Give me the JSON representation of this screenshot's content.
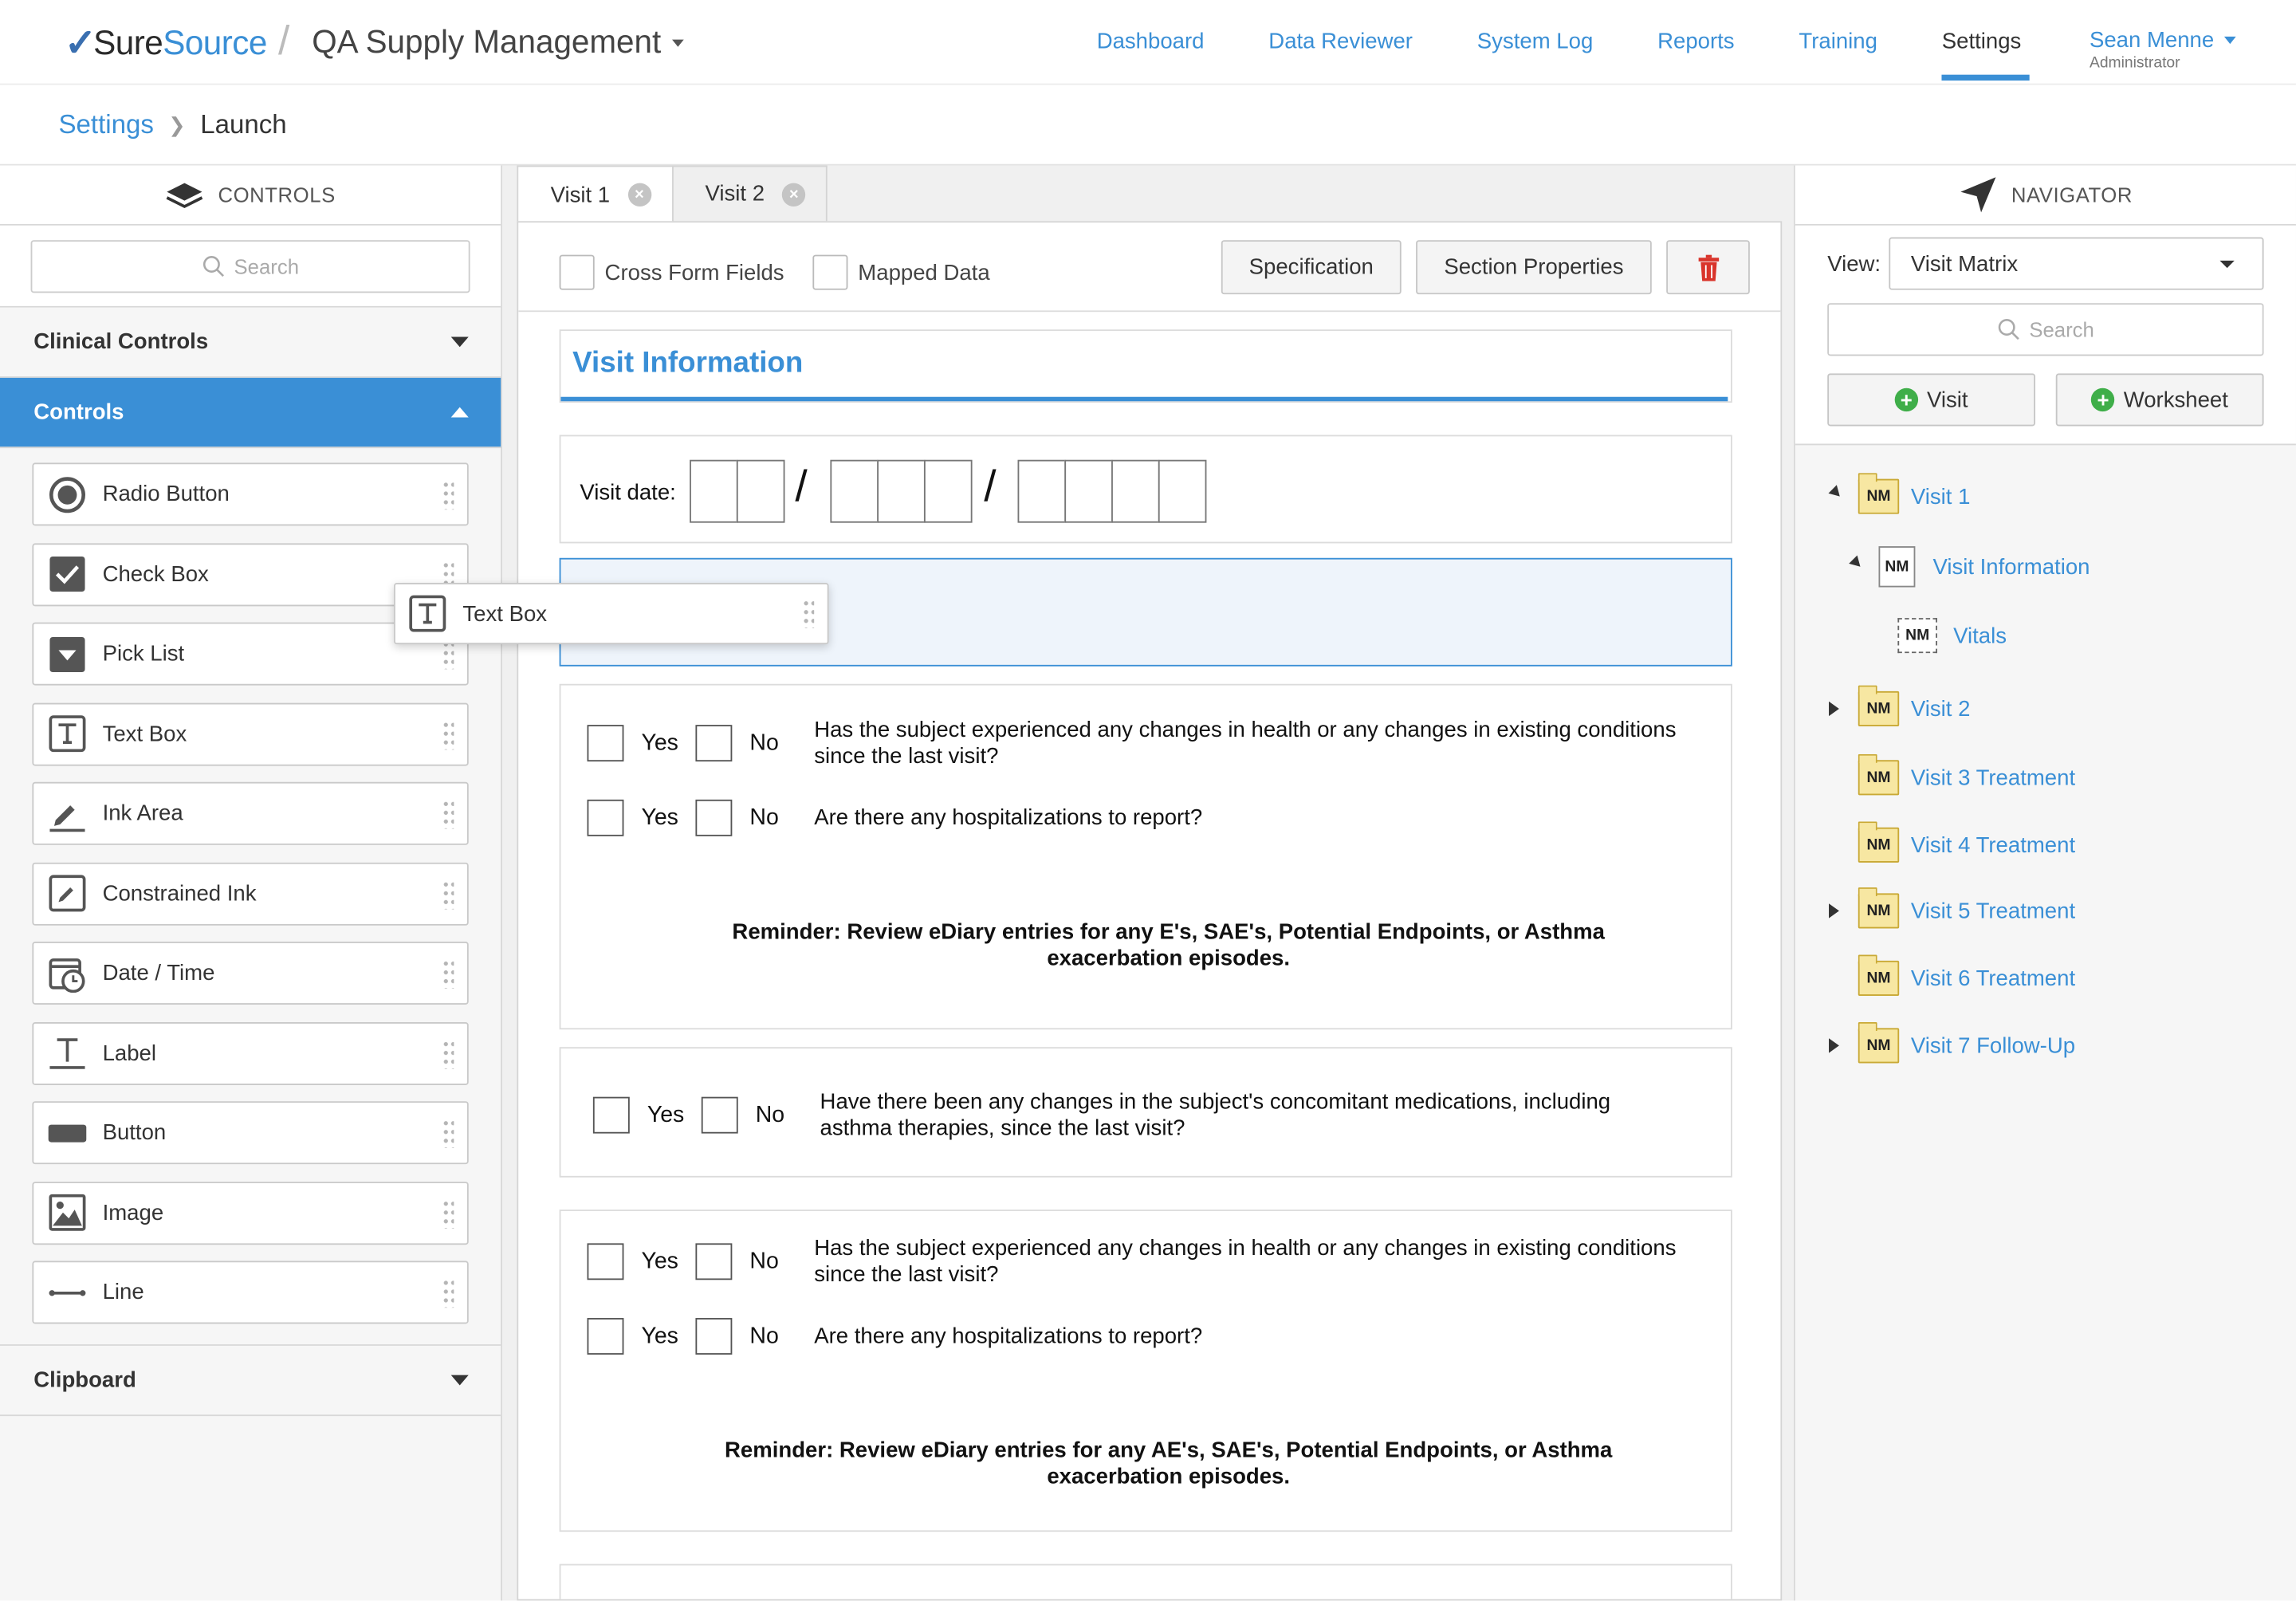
{
  "header": {
    "logo_sure": "Sure",
    "logo_source": "Source",
    "app_title": "QA Supply Management",
    "nav": [
      "Dashboard",
      "Data Reviewer",
      "System Log",
      "Reports",
      "Training",
      "Settings"
    ],
    "nav_active": "Settings",
    "user_name": "Sean Menne",
    "user_role": "Administrator"
  },
  "breadcrumb": {
    "parent": "Settings",
    "current": "Launch"
  },
  "left_panel": {
    "title": "CONTROLS",
    "search_placeholder": "Search",
    "sections": {
      "clinical": "Clinical Controls",
      "controls": "Controls",
      "clipboard": "Clipboard"
    },
    "controls": [
      {
        "label": "Radio Button",
        "icon": "radio-button-icon"
      },
      {
        "label": "Check Box",
        "icon": "check-box-icon"
      },
      {
        "label": "Pick List",
        "icon": "pick-list-icon"
      },
      {
        "label": "Text Box",
        "icon": "text-box-icon"
      },
      {
        "label": "Ink Area",
        "icon": "ink-area-icon"
      },
      {
        "label": "Constrained Ink",
        "icon": "constrained-ink-icon"
      },
      {
        "label": "Date / Time",
        "icon": "date-time-icon"
      },
      {
        "label": "Label",
        "icon": "label-icon"
      },
      {
        "label": "Button",
        "icon": "button-icon"
      },
      {
        "label": "Image",
        "icon": "image-icon"
      },
      {
        "label": "Line",
        "icon": "line-icon"
      }
    ],
    "drag_ghost_label": "Text Box"
  },
  "center": {
    "tabs": [
      "Visit 1",
      "Visit 2"
    ],
    "toolbar": {
      "cross_form": "Cross Form Fields",
      "mapped_data": "Mapped Data",
      "specification": "Specification",
      "section_properties": "Section Properties"
    },
    "section_title": "Visit Information",
    "visit_date_label": "Visit date:",
    "yes": "Yes",
    "no": "No",
    "q_health": "Has the subject experienced any changes in health or any changes in existing conditions since the last visit?",
    "q_health_line1": "Has the subject experienced any changes in health or any changes in existing conditions",
    "q_health_line2": "since the last visit?",
    "q_hosp": "Are there any hospitalizations to report?",
    "q_meds_line1": "Have there been any changes in the subject's concomitant medications, including",
    "q_meds_line2": "asthma therapies, since the last visit?",
    "reminder1_line1": "Reminder:  Review eDiary entries for any   E's, SAE's, Potential Endpoints, or Asthma",
    "reminder2_line1": "Reminder:  Review eDiary entries for any AE's, SAE's, Potential Endpoints, or Asthma",
    "reminder_line2": "exacerbation episodes."
  },
  "right_panel": {
    "title": "NAVIGATOR",
    "view_label": "View:",
    "view_value": "Visit Matrix",
    "search_placeholder": "Search",
    "add_visit": "Visit",
    "add_worksheet": "Worksheet",
    "nm": "NM",
    "tree": {
      "visit1": "Visit 1",
      "visit_info": "Visit Information",
      "vitals": "Vitals",
      "visit2": "Visit 2",
      "visit3": "Visit 3 Treatment",
      "visit4": "Visit 4 Treatment",
      "visit5": "Visit 5 Treatment",
      "visit6": "Visit 6 Treatment",
      "visit7": "Visit 7 Follow-Up"
    }
  },
  "colors": {
    "accent": "#3a8fd6",
    "delete": "#d9342b",
    "add": "#3fae49",
    "folder": "#f7e7a2"
  }
}
